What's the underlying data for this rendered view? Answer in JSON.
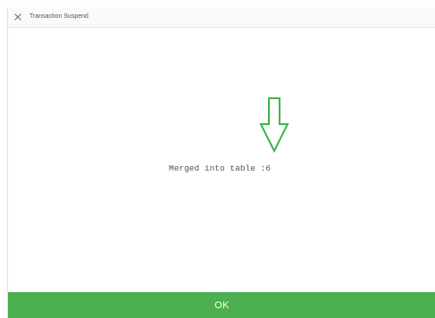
{
  "dialog": {
    "title": "Transaction Suspend",
    "close_icon": "close-icon",
    "message": "Merged into table :6",
    "ok_label": "OK"
  },
  "annotation": {
    "arrow_icon": "down-arrow-icon",
    "arrow_color": "#3cb54a"
  },
  "colors": {
    "accent": "#4caf50",
    "text": "#555555",
    "titlebar_bg": "#fafafa"
  }
}
